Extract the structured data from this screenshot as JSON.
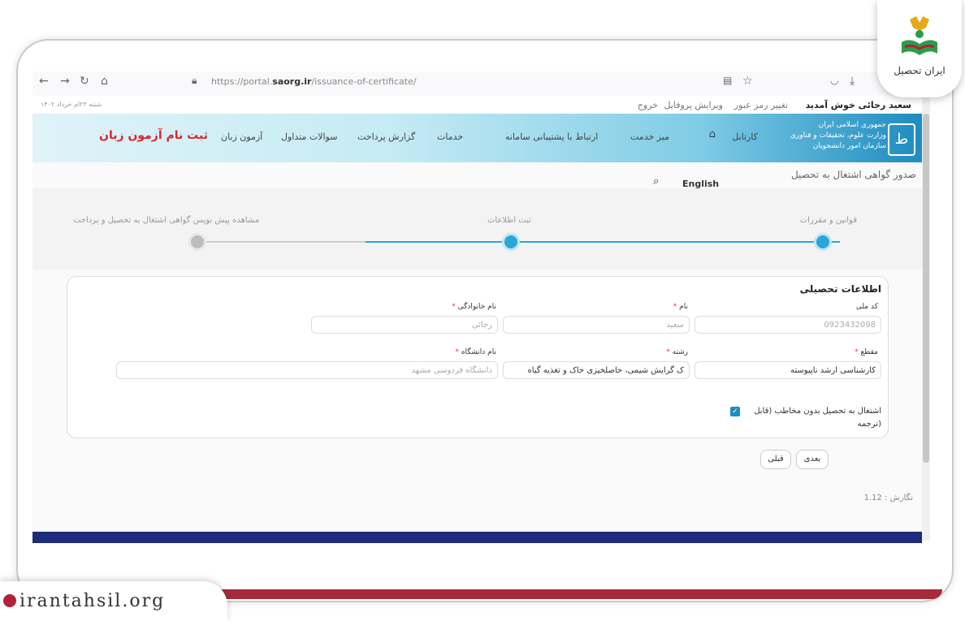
{
  "browser": {
    "url_prefix": "https://portal.",
    "url_domain": "saorg.ir",
    "url_path": "/issuance-of-certificate/"
  },
  "topbar": {
    "welcome": "سعید رجائی خوش آمدید",
    "change_password": "تغییر رمز عبور",
    "edit_profile": "ویرایش پروفایل",
    "logout": "خروج",
    "date": "شنبه ۲۳ام خرداد ۱۴۰۲"
  },
  "header": {
    "org_line1": "جمهوری اسلامی ایران",
    "org_line2": "وزارت علوم، تحقیقات و فناوری",
    "org_line3": "سازمان امور دانشجویان",
    "menu": [
      "کارتابل",
      "میز خدمت",
      "ارتباط با پشتیبانی سامانه",
      "خدمات",
      "گزارش پرداخت",
      "سوالات متداول",
      "آزمون زبان"
    ],
    "register_exam": "ثبت نام آزمون زبان"
  },
  "page": {
    "title": "صدور گواهی اشتغال به تحصیل",
    "english": "English"
  },
  "steps": [
    {
      "label": "قوانین و مقررات",
      "state": "done"
    },
    {
      "label": "ثبت اطلاعات",
      "state": "active"
    },
    {
      "label": "مشاهده پیش نویس گواهی اشتغال به تحصیل و پرداخت",
      "state": "pending"
    }
  ],
  "form": {
    "section_title": "اطلاعات تحصیلی",
    "national_code_label": "کد ملی",
    "national_code_value": "0923432098",
    "first_name_label": "نام",
    "first_name_value": "سعید",
    "last_name_label": "نام خانوادگی",
    "last_name_value": "رجائی",
    "level_label": "مقطع",
    "level_value": "کارشناسی ارشد ناپیوسته",
    "major_label": "رشته",
    "major_value": "ک گرایش شیمی، حاصلخیزی خاک و تغذیه گیاه",
    "university_label": "نام دانشگاه",
    "university_value": "دانشگاه فردوسی مشهد",
    "checkbox_label_1": "اشتغال به تحصیل بدون مخاطب (قابل",
    "checkbox_label_2": "ترجمه)",
    "next": "بعدی",
    "prev": "قبلی"
  },
  "version": "نگارش : 1.12",
  "brand": {
    "logo_text": "ایران تحصیل",
    "site": "irantahsil.org"
  },
  "colors": {
    "accent": "#1e8cc0",
    "step_active": "#2aa6d8",
    "register_red": "#e0232b",
    "footer": "#1e2a7a"
  }
}
